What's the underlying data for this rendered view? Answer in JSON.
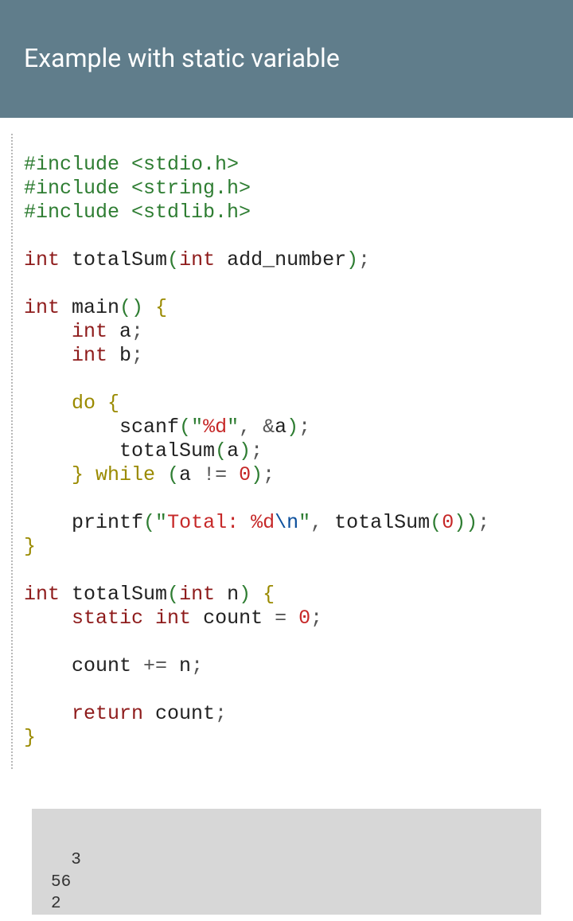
{
  "header": {
    "title": "Example with static variable"
  },
  "code": {
    "tokens": [
      {
        "c": "c-preproc",
        "t": "#include <stdio.h>"
      },
      {
        "br": 1
      },
      {
        "c": "c-preproc",
        "t": "#include <string.h>"
      },
      {
        "br": 1
      },
      {
        "c": "c-preproc",
        "t": "#include <stdlib.h>"
      },
      {
        "br": 1
      },
      {
        "br": 1
      },
      {
        "c": "c-type",
        "t": "int"
      },
      {
        "c": "c-ident",
        "t": " totalSum"
      },
      {
        "c": "c-paren",
        "t": "("
      },
      {
        "c": "c-type",
        "t": "int"
      },
      {
        "c": "c-ident",
        "t": " add_number"
      },
      {
        "c": "c-paren",
        "t": ")"
      },
      {
        "c": "c-punct",
        "t": ";"
      },
      {
        "br": 1
      },
      {
        "br": 1
      },
      {
        "c": "c-type",
        "t": "int"
      },
      {
        "c": "c-ident",
        "t": " main"
      },
      {
        "c": "c-paren",
        "t": "()"
      },
      {
        "c": "c-ident",
        "t": " "
      },
      {
        "c": "c-brace",
        "t": "{"
      },
      {
        "br": 1
      },
      {
        "c": "c-ident",
        "t": "    "
      },
      {
        "c": "c-type",
        "t": "int"
      },
      {
        "c": "c-ident",
        "t": " a"
      },
      {
        "c": "c-punct",
        "t": ";"
      },
      {
        "br": 1
      },
      {
        "c": "c-ident",
        "t": "    "
      },
      {
        "c": "c-type",
        "t": "int"
      },
      {
        "c": "c-ident",
        "t": " b"
      },
      {
        "c": "c-punct",
        "t": ";"
      },
      {
        "br": 1
      },
      {
        "br": 1
      },
      {
        "c": "c-ident",
        "t": "    "
      },
      {
        "c": "c-kw",
        "t": "do"
      },
      {
        "c": "c-ident",
        "t": " "
      },
      {
        "c": "c-brace",
        "t": "{"
      },
      {
        "br": 1
      },
      {
        "c": "c-ident",
        "t": "        scanf"
      },
      {
        "c": "c-paren",
        "t": "("
      },
      {
        "c": "c-strq",
        "t": "\""
      },
      {
        "c": "c-str",
        "t": "%d"
      },
      {
        "c": "c-strq",
        "t": "\""
      },
      {
        "c": "c-punct",
        "t": ", "
      },
      {
        "c": "c-punct",
        "t": "&"
      },
      {
        "c": "c-ident",
        "t": "a"
      },
      {
        "c": "c-paren",
        "t": ")"
      },
      {
        "c": "c-punct",
        "t": ";"
      },
      {
        "br": 1
      },
      {
        "c": "c-ident",
        "t": "        totalSum"
      },
      {
        "c": "c-paren",
        "t": "("
      },
      {
        "c": "c-ident",
        "t": "a"
      },
      {
        "c": "c-paren",
        "t": ")"
      },
      {
        "c": "c-punct",
        "t": ";"
      },
      {
        "br": 1
      },
      {
        "c": "c-ident",
        "t": "    "
      },
      {
        "c": "c-brace",
        "t": "}"
      },
      {
        "c": "c-ident",
        "t": " "
      },
      {
        "c": "c-kw",
        "t": "while"
      },
      {
        "c": "c-ident",
        "t": " "
      },
      {
        "c": "c-paren",
        "t": "("
      },
      {
        "c": "c-ident",
        "t": "a "
      },
      {
        "c": "c-punct",
        "t": "!= "
      },
      {
        "c": "c-num",
        "t": "0"
      },
      {
        "c": "c-paren",
        "t": ")"
      },
      {
        "c": "c-punct",
        "t": ";"
      },
      {
        "br": 1
      },
      {
        "br": 1
      },
      {
        "c": "c-ident",
        "t": "    printf"
      },
      {
        "c": "c-paren",
        "t": "("
      },
      {
        "c": "c-strq",
        "t": "\""
      },
      {
        "c": "c-str",
        "t": "Total: %d"
      },
      {
        "c": "c-esc",
        "t": "\\n"
      },
      {
        "c": "c-strq",
        "t": "\""
      },
      {
        "c": "c-punct",
        "t": ", "
      },
      {
        "c": "c-ident",
        "t": "totalSum"
      },
      {
        "c": "c-paren",
        "t": "("
      },
      {
        "c": "c-num",
        "t": "0"
      },
      {
        "c": "c-paren",
        "t": "))"
      },
      {
        "c": "c-punct",
        "t": ";"
      },
      {
        "br": 1
      },
      {
        "c": "c-brace",
        "t": "}"
      },
      {
        "br": 1
      },
      {
        "br": 1
      },
      {
        "c": "c-type",
        "t": "int"
      },
      {
        "c": "c-ident",
        "t": " totalSum"
      },
      {
        "c": "c-paren",
        "t": "("
      },
      {
        "c": "c-type",
        "t": "int"
      },
      {
        "c": "c-ident",
        "t": " n"
      },
      {
        "c": "c-paren",
        "t": ")"
      },
      {
        "c": "c-ident",
        "t": " "
      },
      {
        "c": "c-brace",
        "t": "{"
      },
      {
        "br": 1
      },
      {
        "c": "c-ident",
        "t": "    "
      },
      {
        "c": "c-type",
        "t": "static"
      },
      {
        "c": "c-ident",
        "t": " "
      },
      {
        "c": "c-type",
        "t": "int"
      },
      {
        "c": "c-ident",
        "t": " count "
      },
      {
        "c": "c-punct",
        "t": "= "
      },
      {
        "c": "c-num",
        "t": "0"
      },
      {
        "c": "c-punct",
        "t": ";"
      },
      {
        "br": 1
      },
      {
        "br": 1
      },
      {
        "c": "c-ident",
        "t": "    count "
      },
      {
        "c": "c-punct",
        "t": "+= "
      },
      {
        "c": "c-ident",
        "t": "n"
      },
      {
        "c": "c-punct",
        "t": ";"
      },
      {
        "br": 1
      },
      {
        "br": 1
      },
      {
        "c": "c-ident",
        "t": "    "
      },
      {
        "c": "c-type",
        "t": "return"
      },
      {
        "c": "c-ident",
        "t": " count"
      },
      {
        "c": "c-punct",
        "t": ";"
      },
      {
        "br": 1
      },
      {
        "c": "c-brace",
        "t": "}"
      }
    ]
  },
  "output": {
    "text": "3\n56\n2"
  }
}
